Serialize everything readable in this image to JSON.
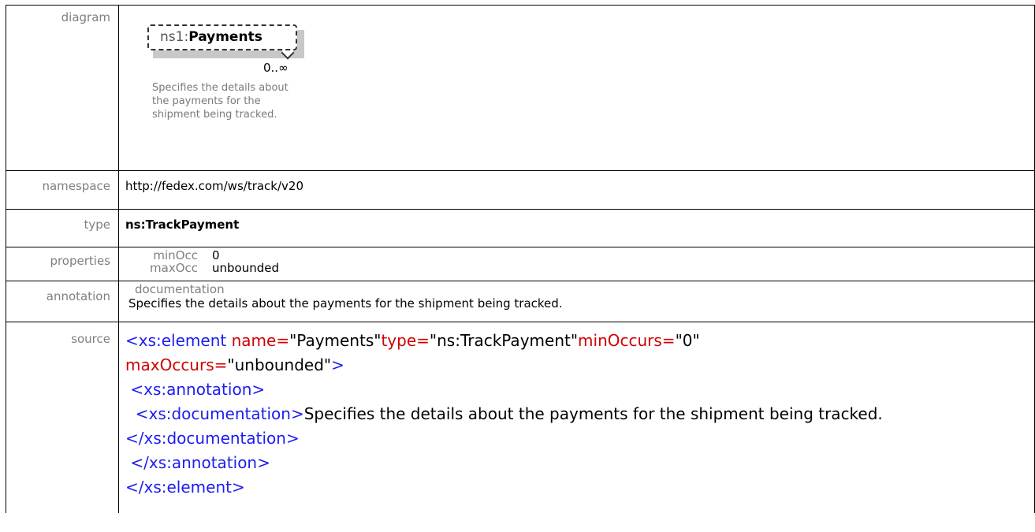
{
  "labels": {
    "diagram": "diagram",
    "namespace": "namespace",
    "type": "type",
    "properties": "properties",
    "annotation": "annotation",
    "source": "source"
  },
  "diagram": {
    "prefix": "ns1:",
    "name": "Payments",
    "occurs": "0..∞",
    "doc_lines": [
      "Specifies the details about",
      "the payments for the",
      "shipment being tracked."
    ]
  },
  "namespace": "http://fedex.com/ws/track/v20",
  "type": "ns:TrackPayment",
  "properties": {
    "min_key": "minOcc",
    "min_val": "0",
    "max_key": "maxOcc",
    "max_val": "unbounded"
  },
  "annotation": {
    "title": "documentation",
    "text": "Specifies the details about the payments for the shipment being tracked."
  },
  "source": {
    "l1_open": "<xs:element ",
    "l1_attr1": "name=",
    "l1_val1": "\"Payments\"",
    "l1_attr2": "type=",
    "l1_val2": "\"ns:TrackPayment\"",
    "l1_attr3": "minOccurs=",
    "l1_val3": "\"0\"",
    "l2_attr4": "maxOccurs=",
    "l2_val4": "\"unbounded\"",
    "l2_close": ">",
    "l3": "<xs:annotation>",
    "l4_open": "<xs:documentation>",
    "l4_text": "Specifies the details about the payments for the shipment being tracked.",
    "l4_close": "</xs:documentation>",
    "l6": "</xs:annotation>",
    "l7": "</xs:element>"
  }
}
